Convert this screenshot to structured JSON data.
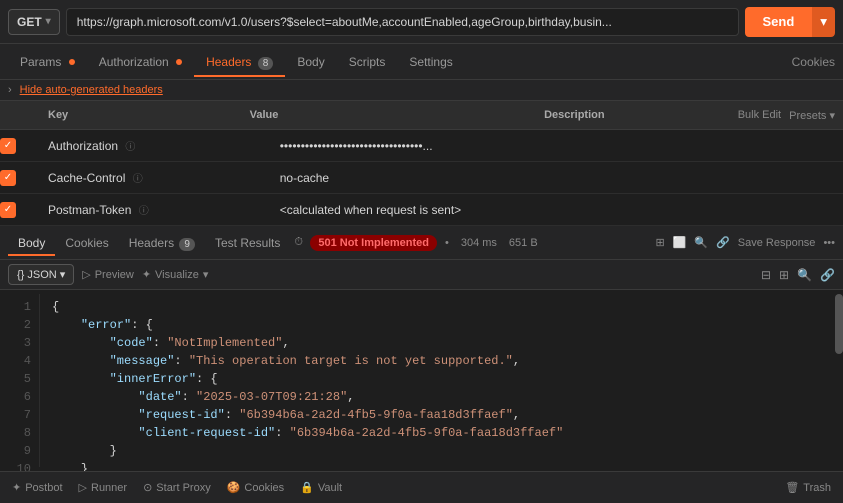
{
  "method": {
    "value": "GET",
    "chevron": "▾"
  },
  "url": {
    "value": "https://graph.microsoft.com/v1.0/users?$select=aboutMe,accountEnabled,ageGroup,birthday,busin..."
  },
  "send_button": {
    "label": "Send",
    "dropdown_icon": "▾"
  },
  "nav_tabs": [
    {
      "id": "params",
      "label": "Params",
      "dot": true,
      "active": false
    },
    {
      "id": "authorization",
      "label": "Authorization",
      "dot": true,
      "active": false
    },
    {
      "id": "headers",
      "label": "Headers",
      "badge": "8",
      "active": true
    },
    {
      "id": "body",
      "label": "Body",
      "active": false
    },
    {
      "id": "scripts",
      "label": "Scripts",
      "active": false
    },
    {
      "id": "settings",
      "label": "Settings",
      "active": false
    }
  ],
  "cookies_link": "Cookies",
  "headers_sub": "Hide auto-generated headers",
  "table_header": {
    "key": "Key",
    "value": "Value",
    "description": "Description",
    "bulk_edit": "Bulk Edit",
    "presets": "Presets"
  },
  "table_rows": [
    {
      "checked": true,
      "key": "Authorization",
      "value": "••••••••••••••••••••••••••••••••••...",
      "desc": ""
    },
    {
      "checked": true,
      "key": "Cache-Control",
      "value": "no-cache",
      "desc": ""
    },
    {
      "checked": true,
      "key": "Postman-Token",
      "value": "<calculated when request is sent>",
      "desc": ""
    }
  ],
  "response_tabs": [
    {
      "id": "body",
      "label": "Body",
      "active": true
    },
    {
      "id": "cookies",
      "label": "Cookies",
      "active": false
    },
    {
      "id": "headers",
      "label": "Headers",
      "badge": "9",
      "active": false
    },
    {
      "id": "test_results",
      "label": "Test Results",
      "active": false
    }
  ],
  "status": {
    "label": "501 Not Implemented",
    "time": "304 ms",
    "size": "651 B"
  },
  "response_actions": {
    "save": "Save Response",
    "more": "•••"
  },
  "json_toolbar": {
    "format": "JSON",
    "format_icon": "{}",
    "preview": "Preview",
    "visualize": "Visualize"
  },
  "json_lines": [
    {
      "num": "1",
      "content": "{"
    },
    {
      "num": "2",
      "content": "    \"error\": {"
    },
    {
      "num": "3",
      "content": "        \"code\": \"NotImplemented\","
    },
    {
      "num": "4",
      "content": "        \"message\": \"This operation target is not yet supported.\","
    },
    {
      "num": "5",
      "content": "        \"innerError\": {"
    },
    {
      "num": "6",
      "content": "            \"date\": \"2025-03-07T09:21:28\","
    },
    {
      "num": "7",
      "content": "            \"request-id\": \"6b394b6a-2a2d-4fb5-9f0a-faa18d3ffaef\","
    },
    {
      "num": "8",
      "content": "            \"client-request-id\": \"6b394b6a-2a2d-4fb5-9f0a-faa18d3ffaef\""
    },
    {
      "num": "9",
      "content": "        }"
    },
    {
      "num": "10",
      "content": "    }"
    }
  ],
  "bottom_bar": {
    "postbot": "Postbot",
    "runner": "Runner",
    "start_proxy": "Start Proxy",
    "cookies": "Cookies",
    "vault": "Vault",
    "trash": "Trash"
  }
}
